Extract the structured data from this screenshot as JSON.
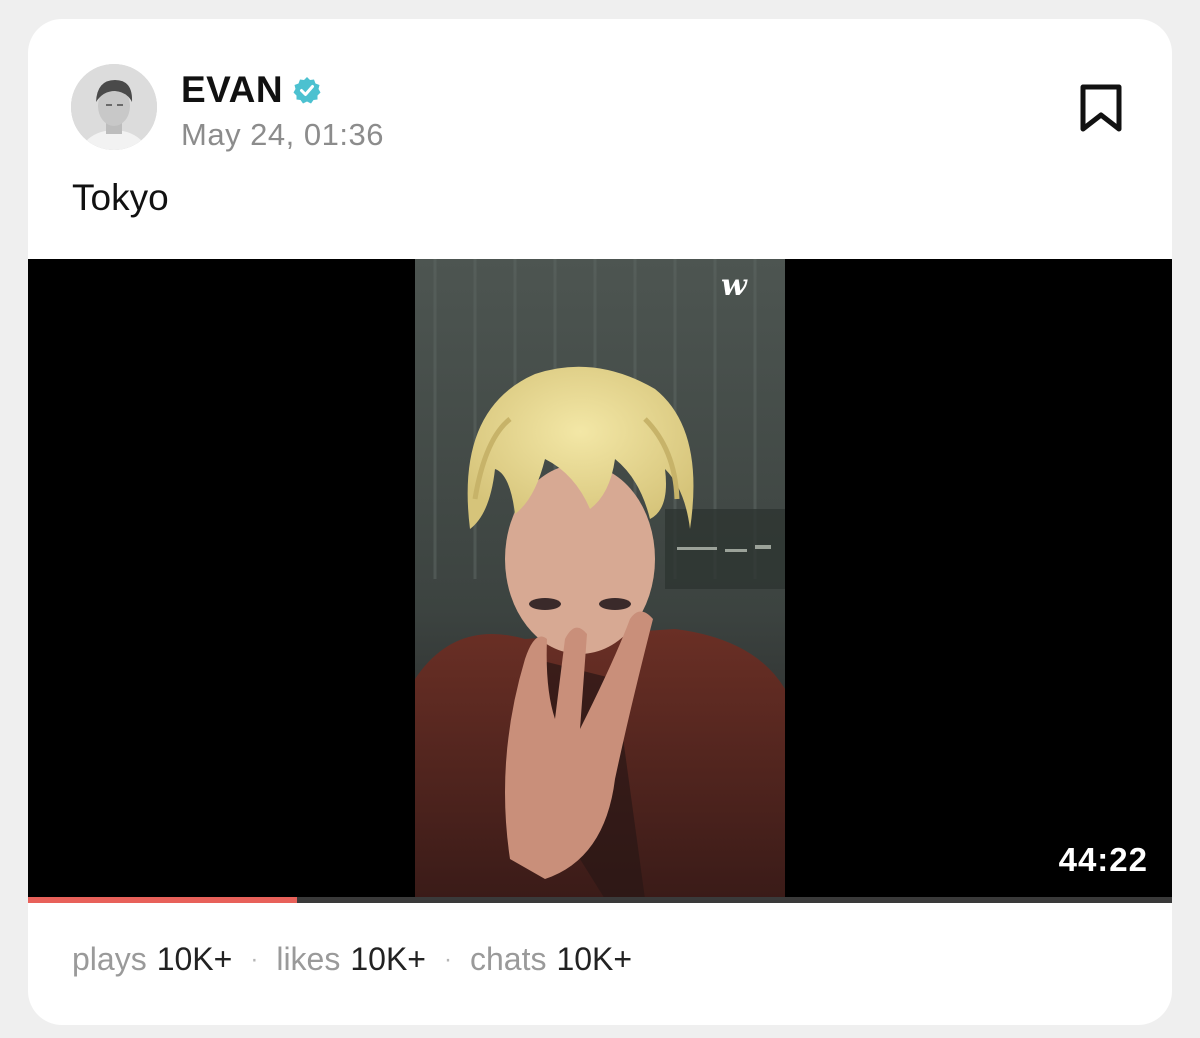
{
  "post": {
    "author": "EVAN",
    "verified": true,
    "timestamp": "May 24, 01:36",
    "caption": "Tokyo"
  },
  "video": {
    "watermark": "w",
    "duration": "44:22",
    "progress": 0.235
  },
  "stats": {
    "plays_label": "plays",
    "plays_value": "10K+",
    "likes_label": "likes",
    "likes_value": "10K+",
    "chats_label": "chats",
    "chats_value": "10K+",
    "separator": "·"
  },
  "colors": {
    "verified_badge": "#4cc1d0",
    "progress": "#e8615a",
    "text_primary": "#111111",
    "text_secondary": "#8c8c8c"
  },
  "icons": {
    "bookmark": "bookmark-icon",
    "verified": "verified-badge-icon"
  }
}
